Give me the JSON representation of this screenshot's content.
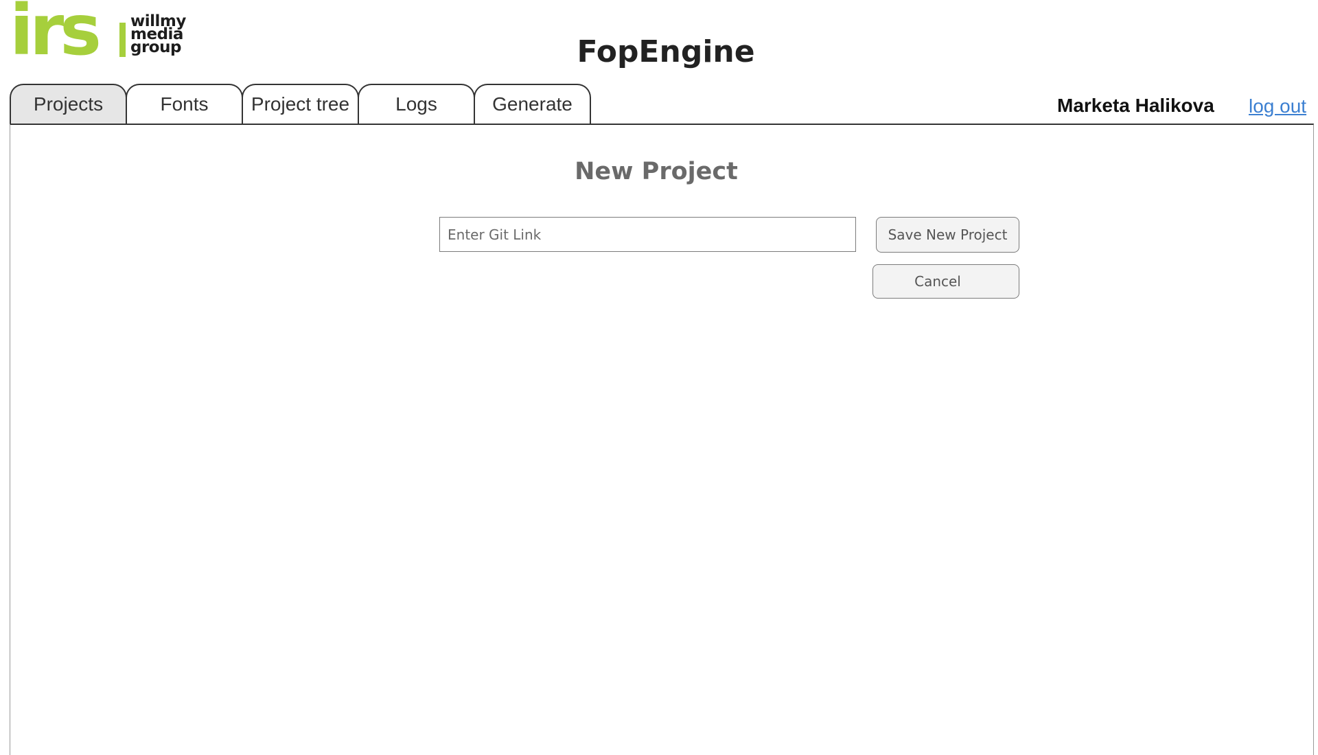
{
  "logo": {
    "irs": "irs",
    "willmy_lines": [
      "willmy",
      "media",
      "group"
    ]
  },
  "header": {
    "title": "FopEngine"
  },
  "tabs": [
    {
      "label": "Projects",
      "active": true
    },
    {
      "label": "Fonts",
      "active": false
    },
    {
      "label": "Project tree",
      "active": false
    },
    {
      "label": "Logs",
      "active": false
    },
    {
      "label": "Generate",
      "active": false
    }
  ],
  "user": {
    "name": "Marketa Halikova",
    "logout_label": "log out"
  },
  "new_project": {
    "title": "New Project",
    "git_input": {
      "value": "",
      "placeholder": "Enter Git Link"
    },
    "save_label": "Save New Project",
    "cancel_label": "Cancel"
  },
  "colors": {
    "brand_green": "#a6cf3c",
    "link_blue": "#3b7fd1",
    "active_tab_bg": "#e6e6e6"
  }
}
